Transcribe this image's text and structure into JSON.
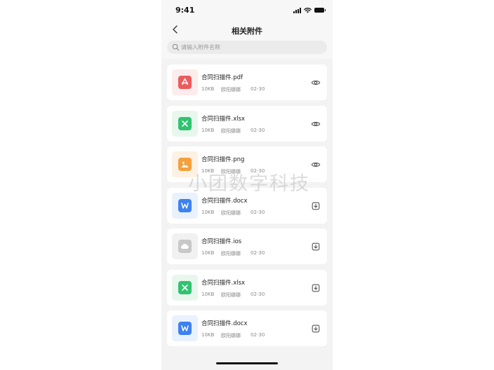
{
  "status_bar": {
    "time": "9:41"
  },
  "header": {
    "title": "相关附件"
  },
  "search": {
    "placeholder": "请输入附件名称",
    "value": ""
  },
  "colors": {
    "pdf": "#ec5b5b",
    "pdf_bg": "#fdecec",
    "xlsx": "#2fc46f",
    "xlsx_bg": "#e8f7ee",
    "png": "#f4a13b",
    "png_bg": "#fdf1e3",
    "docx": "#3d82f0",
    "docx_bg": "#e9f1fd",
    "ios": "#c8c8c8",
    "ios_bg": "#f1f1f1"
  },
  "files": [
    {
      "name": "合同扫描件.pdf",
      "size": "10KB",
      "owner": "欧阳娜娜",
      "date": "02-30",
      "type": "pdf",
      "action": "preview-icon"
    },
    {
      "name": "合同扫描件.xlsx",
      "size": "10KB",
      "owner": "欧阳娜娜",
      "date": "02-30",
      "type": "xlsx",
      "action": "preview-icon"
    },
    {
      "name": "合同扫描件.png",
      "size": "10KB",
      "owner": "欧阳娜娜",
      "date": "02-30",
      "type": "png",
      "action": "preview-icon"
    },
    {
      "name": "合同扫描件.docx",
      "size": "10KB",
      "owner": "欧阳娜娜",
      "date": "02-30",
      "type": "docx",
      "action": "download-icon"
    },
    {
      "name": "合同扫描件.ios",
      "size": "10KB",
      "owner": "欧阳娜娜",
      "date": "02-30",
      "type": "ios",
      "action": "download-icon"
    },
    {
      "name": "合同扫描件.xlsx",
      "size": "10KB",
      "owner": "欧阳娜娜",
      "date": "02-30",
      "type": "xlsx",
      "action": "download-icon"
    },
    {
      "name": "合同扫描件.docx",
      "size": "10KB",
      "owner": "欧阳娜娜",
      "date": "02-30",
      "type": "docx",
      "action": "download-icon"
    }
  ],
  "watermark": "小团数字科技"
}
